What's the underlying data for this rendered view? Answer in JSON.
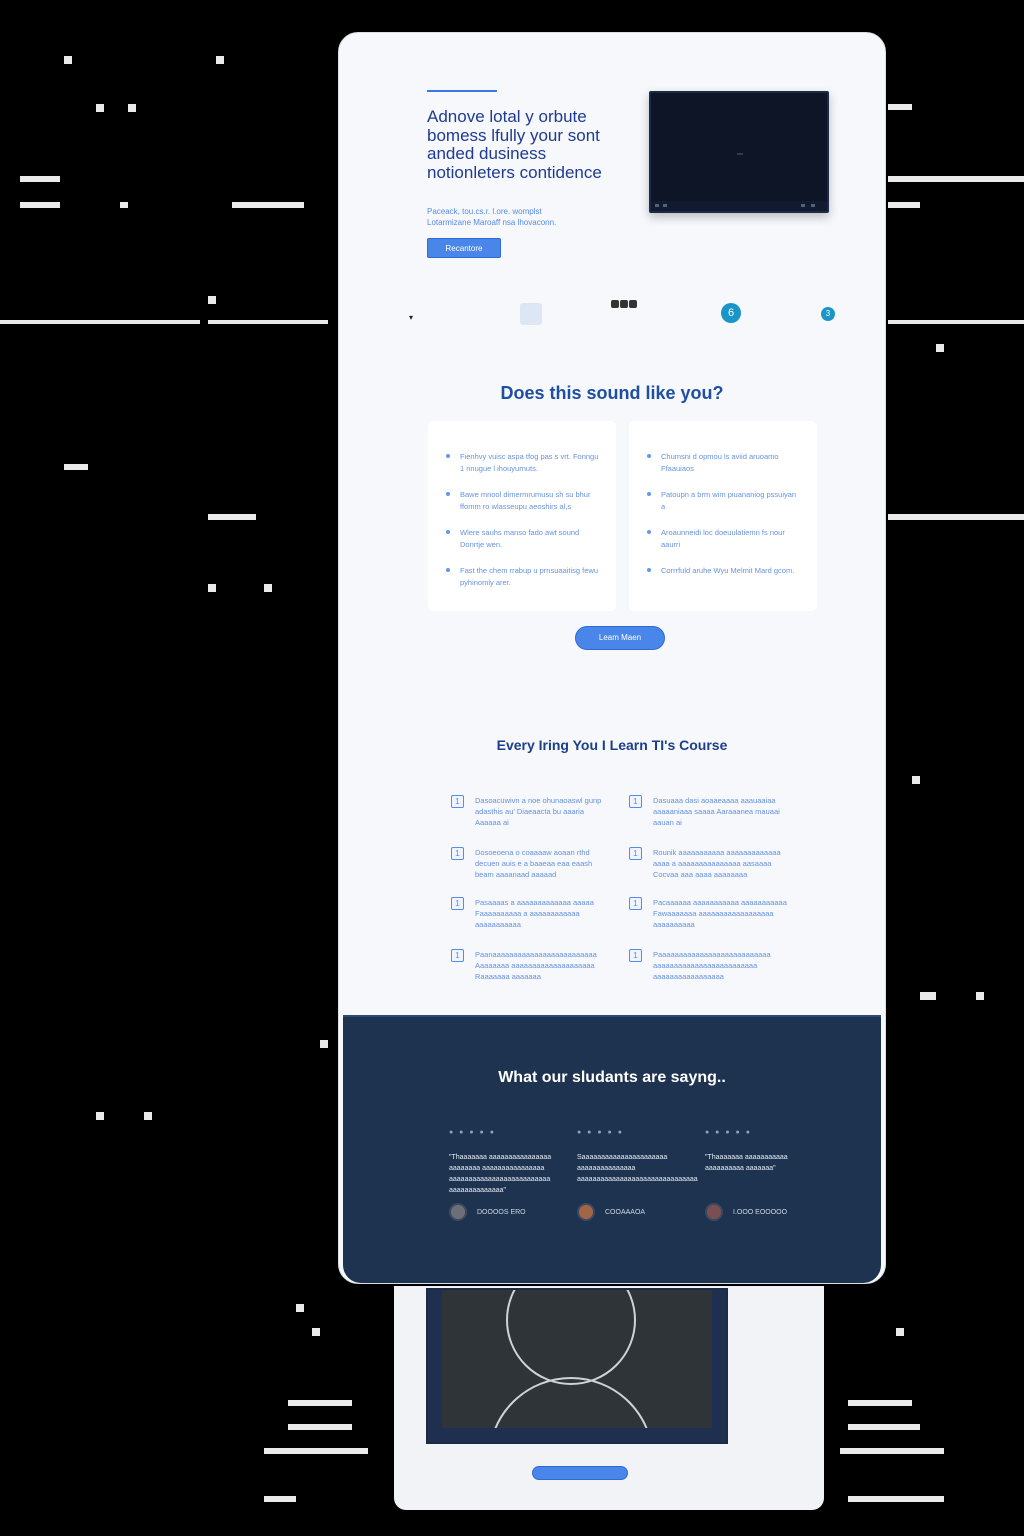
{
  "hero": {
    "title": "Adnove lotal y orbute bomess lfully your sont anded dusiness notionleters contidence",
    "subtitle": "Paceack, tou.cs.r. l.ore. womplst Lotarmizane Maroaff nsa lhovaconn.",
    "cta_label": "Recantore"
  },
  "logos": {
    "circle_a": "6",
    "circle_b": "3"
  },
  "sound_section": {
    "title": "Does this sound like you?",
    "left_items": [
      "Fienhvy vuisc aspa tfog pas s vrt. Fonngu 1 nnugue l ihouyurnuts.",
      "Bawe mnool dimermrumusu sh su bhur ffomm ro wlasseupu aeoshirs al,s",
      "Wlere sauhs manso fado awt sound Donrtje wen.",
      "Fast the chem rrabup u prnsuaaitisg fewu pyhinomly arer."
    ],
    "right_items": [
      "Chumsni d opmou ls aviid aruoamo Ffaauiaos",
      "Patoupn a brm wim piuananiog pssuiyan a",
      "Aroaunneidi loc doeuulatiemn fs nour aaurri",
      "Corrrfuld aruhe Wyu Melmit Mard gcom."
    ],
    "cta_label": "Leam Maen"
  },
  "learn_section": {
    "title": "Every Iring You I Learn TI's Course",
    "features": [
      {
        "icon": "1",
        "text": "Dasoacuwivn a noe ohunaoaswl gunp adasthis au' Diaeaacta bu aaaria Aaaaaa ai"
      },
      {
        "icon": "1",
        "text": "Dasuaaa dasi aoaaeaaaa aaauaaiaa aaaaaniaaa saaaa Aaraaanea mauaai aauan ai"
      },
      {
        "icon": "1",
        "text": "Dosoeoena o coaaaaw aoaan rthd decuen auis e a baaeaa eaa eaash beam aaaanaad aaaaad"
      },
      {
        "icon": "1",
        "text": "Rounik aaaaaaaaaaa aaaaaaaaaaaaa aaaa a aaaaaaaaaaaaaaa aasaaaa Cocvaa aaa aaaa aaaaaaaa"
      },
      {
        "icon": "1",
        "text": "Pasaaaas a aaaaaaaaaaaaa aaaaa Faaaaaaaaaa a aaaaaaaaaaaa aaaaaaaaaaa"
      },
      {
        "icon": "1",
        "text": "Pacaaaaaa aaaaaaaaaaa aaaaaaaaaaa Fawaaaaaaa aaaaaaaaaaaaaaaaaa aaaaaaaaaa"
      },
      {
        "icon": "1",
        "text": "Paanaaaaaaaaaaaaaaaaaaaaaaaaa Aaaaaaaa aaaaaaaaaaaaaaaaaaaa Raaaaaaa aaaaaaa"
      },
      {
        "icon": "1",
        "text": "Paaaaaaaaaaaaaaaaaaaaaaaaaaa aaaaaaaaaaaaaaaaaaaaaaaaa aaaaaaaaaaaaaaaaa"
      }
    ]
  },
  "testimonials": {
    "title": "What our sludants are sayng..",
    "items": [
      {
        "stars": "● ● ● ● ●",
        "quote": "\"Thaaaaaaa aaaaaaaaaaaaaaaa aaaaaaaa aaaaaaaaaaaaaaaa aaaaaaaaaaaaaaaaaaaaaaaaaa aaaaaaaaaaaaaa\"",
        "name": "DOOOOS ERO"
      },
      {
        "stars": "● ● ● ● ●",
        "quote": "Saaaaaaaaaaaaaaaaaaaaaa aaaaaaaaaaaaaaa aaaaaaaaaaaaaaaaaaaaaaaaaaaaaaa",
        "name": "COOAAAOA"
      },
      {
        "stars": "● ● ● ● ●",
        "quote": "\"Thaaaaaaa aaaaaaaaaaa aaaaaaaaaa aaaaaaa\"",
        "name": "I.OOO EOOOOO"
      }
    ]
  }
}
